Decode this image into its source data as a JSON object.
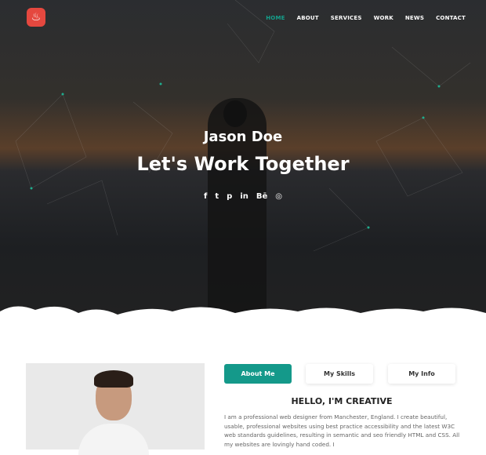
{
  "nav": {
    "logo_icon": "flame-icon",
    "items": [
      "HOME",
      "ABOUT",
      "SERVICES",
      "WORK",
      "NEWS",
      "CONTACT"
    ],
    "active": "HOME"
  },
  "hero": {
    "name": "Jason Doe",
    "tagline": "Let's Work Together",
    "social": [
      {
        "icon": "facebook-icon",
        "glyph": "f"
      },
      {
        "icon": "twitter-icon",
        "glyph": "t"
      },
      {
        "icon": "pinterest-icon",
        "glyph": "p"
      },
      {
        "icon": "linkedin-icon",
        "glyph": "in"
      },
      {
        "icon": "behance-icon",
        "glyph": "Bē"
      },
      {
        "icon": "instagram-icon",
        "glyph": "◎"
      }
    ]
  },
  "about": {
    "tabs": [
      "About Me",
      "My Skills",
      "My Info"
    ],
    "active_tab": "About Me",
    "heading": "HELLO, I'M CREATIVE",
    "text": "I am a professional web designer from Manchester, England. I create beautiful, usable, professional websites using best practice accessibility and the latest W3C web standards guidelines, resulting in semantic and seo friendly HTML and CSS. All my websites are lovingly hand coded. I"
  },
  "colors": {
    "accent": "#14998a",
    "logo": "#e5483f"
  }
}
